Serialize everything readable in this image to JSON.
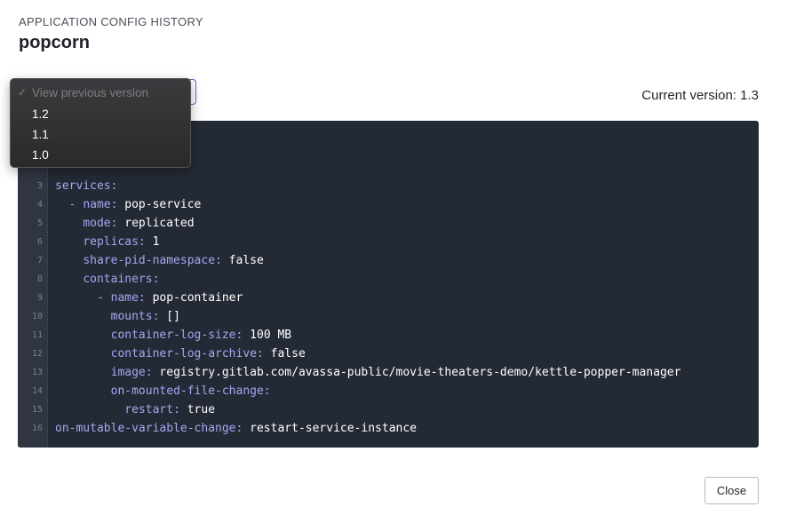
{
  "header": {
    "eyebrow": "APPLICATION CONFIG HISTORY",
    "title": "popcorn"
  },
  "version_select": {
    "placeholder": "View previous version",
    "check_glyph": "✓",
    "options": [
      "1.2",
      "1.1",
      "1.0"
    ]
  },
  "current_version": "Current version: 1.3",
  "code": {
    "lines": [
      {
        "n": "3",
        "indent": "",
        "dash": "",
        "key": "services:",
        "value": ""
      },
      {
        "n": "4",
        "indent": "  ",
        "dash": "- ",
        "key": "name:",
        "value": " pop-service"
      },
      {
        "n": "5",
        "indent": "    ",
        "dash": "",
        "key": "mode:",
        "value": " replicated"
      },
      {
        "n": "6",
        "indent": "    ",
        "dash": "",
        "key": "replicas:",
        "value": " 1"
      },
      {
        "n": "7",
        "indent": "    ",
        "dash": "",
        "key": "share-pid-namespace:",
        "value": " false"
      },
      {
        "n": "8",
        "indent": "    ",
        "dash": "",
        "key": "containers:",
        "value": ""
      },
      {
        "n": "9",
        "indent": "      ",
        "dash": "- ",
        "key": "name:",
        "value": " pop-container"
      },
      {
        "n": "10",
        "indent": "        ",
        "dash": "",
        "key": "mounts:",
        "value": " []"
      },
      {
        "n": "11",
        "indent": "        ",
        "dash": "",
        "key": "container-log-size:",
        "value": " 100 MB"
      },
      {
        "n": "12",
        "indent": "        ",
        "dash": "",
        "key": "container-log-archive:",
        "value": " false"
      },
      {
        "n": "13",
        "indent": "        ",
        "dash": "",
        "key": "image:",
        "value": " registry.gitlab.com/avassa-public/movie-theaters-demo/kettle-popper-manager"
      },
      {
        "n": "14",
        "indent": "        ",
        "dash": "",
        "key": "on-mounted-file-change:",
        "value": ""
      },
      {
        "n": "15",
        "indent": "          ",
        "dash": "",
        "key": "restart:",
        "value": " true"
      },
      {
        "n": "16",
        "indent": "",
        "dash": "",
        "key": "on-mutable-variable-change:",
        "value": " restart-service-instance"
      }
    ]
  },
  "footer": {
    "close_label": "Close"
  },
  "colors": {
    "code_background": "#242a35",
    "yaml_key": "#a9a4f0",
    "accent_border": "#6b5fd0"
  }
}
